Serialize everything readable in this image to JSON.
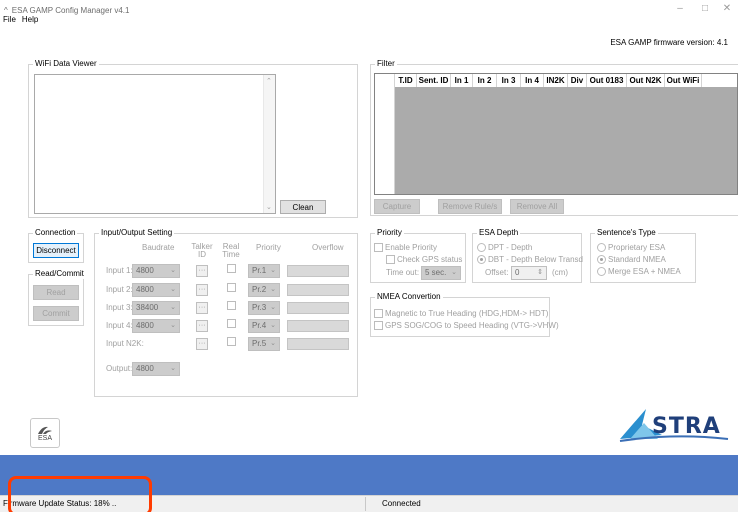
{
  "window": {
    "title": "ESA GAMP Config Manager v4.1",
    "minimize": "–",
    "maximize": "□",
    "close": "✕"
  },
  "menu": {
    "file": "File",
    "help": "Help"
  },
  "firmware_version": "ESA GAMP firmware version: 4.1",
  "wifi_viewer": {
    "label": "WiFi Data Viewer",
    "clean_button": "Clean"
  },
  "filter": {
    "label": "Filter",
    "columns": [
      "T.ID",
      "Sent. ID",
      "In 1",
      "In 2",
      "In 3",
      "In 4",
      "IN2K",
      "Div",
      "Out 0183",
      "Out N2K",
      "Out WiFi"
    ],
    "capture_button": "Capture",
    "remove_rules_button": "Remove Rule/s",
    "remove_all_button": "Remove All"
  },
  "connection": {
    "label": "Connection",
    "disconnect_button": "Disconnect"
  },
  "read_commit": {
    "label": "Read/Commit",
    "read_button": "Read",
    "commit_button": "Commit"
  },
  "io": {
    "label": "Input/Output Setting",
    "headers": {
      "baudrate": "Baudrate",
      "talker_id": "Talker ID",
      "real_time": "Real Time",
      "priority": "Priority",
      "overflow": "Overflow"
    },
    "inputs": [
      {
        "label": "Input 1:",
        "baud": "4800",
        "priority": "Pr.1"
      },
      {
        "label": "Input 2:",
        "baud": "4800",
        "priority": "Pr.2"
      },
      {
        "label": "Input 3:",
        "baud": "38400",
        "priority": "Pr.3"
      },
      {
        "label": "Input 4:",
        "baud": "4800",
        "priority": "Pr.4"
      },
      {
        "label": "Input N2K:",
        "baud": "",
        "priority": "Pr.5"
      }
    ],
    "output": {
      "label": "Output:",
      "baud": "4800"
    },
    "dots": "···"
  },
  "priority": {
    "label": "Priority",
    "enable": "Enable Priority",
    "check_gps": "Check GPS status",
    "timeout_label": "Time out:",
    "timeout_value": "5 sec."
  },
  "esa_depth": {
    "label": "ESA Depth",
    "dpt": "DPT - Depth",
    "dbt": "DBT - Depth Below Transd",
    "offset_label": "Offset:",
    "offset_value": "0",
    "offset_unit": "(cm)"
  },
  "sentence_type": {
    "label": "Sentence's Type",
    "proprietary": "Proprietary ESA",
    "standard": "Standard NMEA",
    "merge": "Merge ESA + NMEA"
  },
  "nmea": {
    "label": "NMEA Convertion",
    "mag_true": "Magnetic to True Heading (HDG,HDM-> HDT)",
    "gps_sog": "GPS SOG/COG to Speed Heading (VTG->VHW)"
  },
  "logos": {
    "esa": "ESA",
    "stra": "STRA"
  },
  "status": {
    "firmware": "Firmware Update Status: 18%  ..",
    "connection": "Connected"
  },
  "colors": {
    "band": "#4e79c6",
    "highlight": "#ff3b00",
    "logo_blue": "#1f3f7a"
  }
}
